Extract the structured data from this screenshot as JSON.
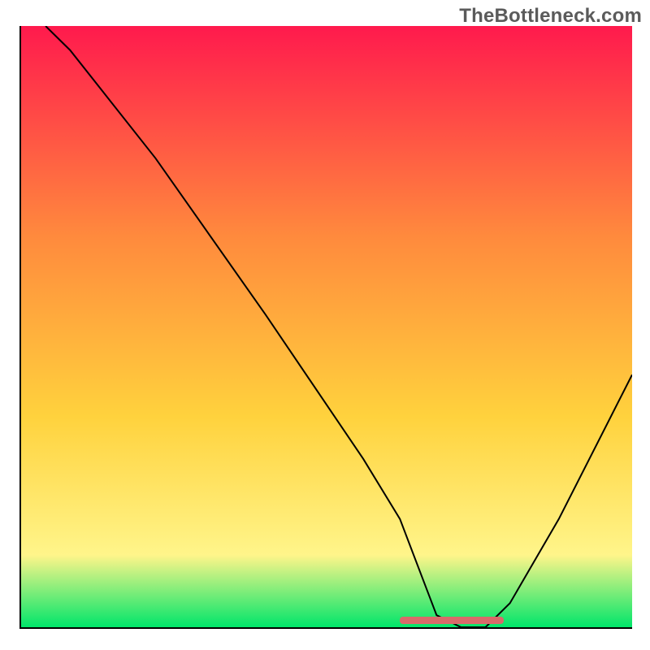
{
  "watermark": "TheBottleneck.com",
  "colors": {
    "gradient_top": "#ff1a4d",
    "gradient_mid1": "#ff8a3d",
    "gradient_mid2": "#ffd23d",
    "gradient_mid3": "#fff58a",
    "gradient_bottom": "#00e56a",
    "curve": "#000000",
    "optimal_bar": "#d96a6a"
  },
  "chart_data": {
    "type": "line",
    "title": "",
    "xlabel": "",
    "ylabel": "",
    "xlim": [
      0,
      100
    ],
    "ylim": [
      0,
      100
    ],
    "series": [
      {
        "name": "bottleneck-curve",
        "x": [
          4,
          8,
          22,
          40,
          56,
          62,
          68,
          72,
          76,
          80,
          88,
          96,
          100
        ],
        "values": [
          100,
          96,
          78,
          52,
          28,
          18,
          2,
          0,
          0,
          4,
          18,
          34,
          42
        ]
      }
    ],
    "optimal_range_x": [
      62,
      79
    ],
    "annotations": []
  }
}
